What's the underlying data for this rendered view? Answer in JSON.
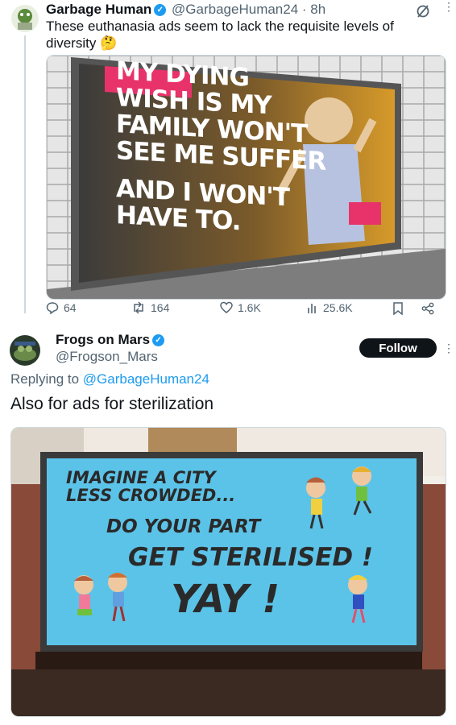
{
  "tweet1": {
    "display_name": "Garbage Human",
    "handle_time": "@GarbageHuman24 · 8h",
    "text_line1": "These euthanasia ads seem to lack the requisite levels of",
    "text_line2": "diversity",
    "emoji": "🤔",
    "image_text": {
      "line1": "MY DYING",
      "line2": "WISH IS MY",
      "line3": "FAMILY WON'T",
      "line4": "SEE ME SUFFER",
      "line5": "AND I WON'T",
      "line6": "HAVE TO."
    },
    "actions": {
      "replies": "64",
      "retweets": "164",
      "likes": "1.6K",
      "views": "25.6K"
    }
  },
  "tweet2": {
    "display_name": "Frogs on Mars",
    "handle": "@Frogson_Mars",
    "follow_label": "Follow",
    "replying_prefix": "Replying to",
    "replying_handle": "@GarbageHuman24",
    "text": "Also for ads for sterilization",
    "image_text": {
      "line1": "IMAGINE A CITY",
      "line2": "LESS CROWDED...",
      "line3": "DO YOUR PART",
      "line4": "GET STERILISED !",
      "line5": "YAY !"
    }
  },
  "icons": [
    "grok-icon",
    "more-icon",
    "reply-icon",
    "retweet-icon",
    "like-icon",
    "views-icon",
    "bookmark-icon",
    "share-icon",
    "verified-icon"
  ],
  "colors": {
    "accent": "#1d9bf0",
    "text": "#0f1419",
    "muted": "#536471",
    "billboard_blue": "#5cc3e8",
    "ad_pink": "#e8336a"
  }
}
